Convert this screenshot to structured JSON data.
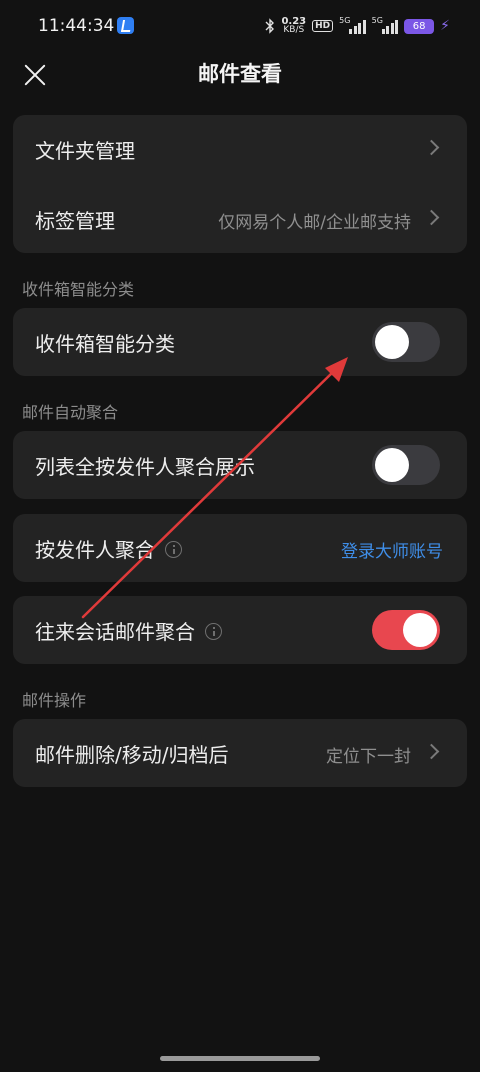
{
  "status": {
    "time": "11:44:34",
    "net_speed": "0.23",
    "net_unit": "KB/S",
    "hd": "HD",
    "sig1": "5G",
    "sig2": "5G",
    "battery": "68"
  },
  "header": {
    "title": "邮件查看"
  },
  "card1": {
    "folder_label": "文件夹管理",
    "tag_label": "标签管理",
    "tag_value": "仅网易个人邮/企业邮支持"
  },
  "section_inbox": {
    "title": "收件箱智能分类",
    "toggle_label": "收件箱智能分类"
  },
  "section_group": {
    "title": "邮件自动聚合",
    "by_sender_all_label": "列表全按发件人聚合展示",
    "by_sender_label": "按发件人聚合",
    "by_sender_link": "登录大师账号",
    "conversation_label": "往来会话邮件聚合"
  },
  "section_ops": {
    "title": "邮件操作",
    "after_delete_label": "邮件删除/移动/归档后",
    "after_delete_value": "定位下一封"
  },
  "toggles": {
    "inbox_smart": false,
    "list_by_sender": false,
    "conversation": true
  },
  "colors": {
    "accent": "#e8474f",
    "link": "#3f8ee8",
    "annotation": "#e03a3a"
  }
}
